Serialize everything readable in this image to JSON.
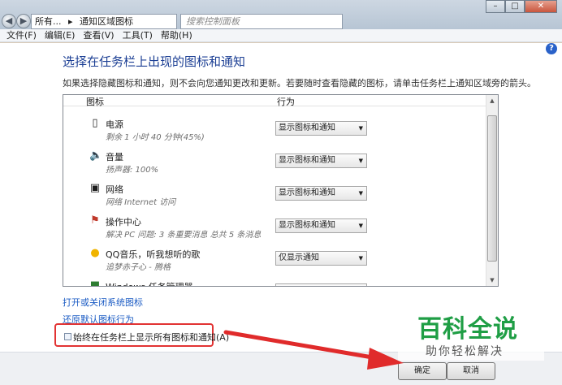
{
  "addressbar": {
    "segments": [
      "所有...",
      "通知区域图标"
    ]
  },
  "search": {
    "placeholder": "搜索控制面板"
  },
  "window_controls": [
    "–",
    "□",
    "✕"
  ],
  "menubar": [
    "文件(F)",
    "编辑(E)",
    "查看(V)",
    "工具(T)",
    "帮助(H)"
  ],
  "help_icon": "?",
  "heading": "选择在任务栏上出现的图标和通知",
  "description": "如果选择隐藏图标和通知，则不会向您通知更改和更新。若要随时查看隐藏的图标，请单击任务栏上通知区域旁的箭头。",
  "list": {
    "col_icon": "图标",
    "col_behavior": "行为",
    "rows": [
      {
        "name": "电源",
        "sub": "剩余 1 小时 40 分钟(45%)",
        "behavior": "显示图标和通知",
        "icon": "battery-icon"
      },
      {
        "name": "音量",
        "sub": "扬声器: 100%",
        "behavior": "显示图标和通知",
        "icon": "speaker-icon"
      },
      {
        "name": "网络",
        "sub": "网络 Internet 访问",
        "behavior": "显示图标和通知",
        "icon": "network-icon"
      },
      {
        "name": "操作中心",
        "sub": "解决 PC 问题: 3 条重要消息 总共 5 条消息",
        "behavior": "显示图标和通知",
        "icon": "flag-icon"
      },
      {
        "name": "QQ音乐，听我想听的歌",
        "sub": "追梦赤子心 - 腾格",
        "behavior": "仅显示通知",
        "icon": "qq-music-icon"
      },
      {
        "name": "Windows 任务管理器",
        "sub": "",
        "behavior": "",
        "icon": "task-manager-icon"
      }
    ]
  },
  "links": {
    "toggle_system_icons": "打开或关闭系统图标",
    "restore_defaults": "还原默认图标行为"
  },
  "checkbox": {
    "label": "始终在任务栏上显示所有图标和通知(A)",
    "checked": false
  },
  "buttons": {
    "ok": "确定",
    "cancel": "取消"
  },
  "watermark": {
    "line1": "百科全说",
    "line2": "助你轻松解决"
  },
  "colors": {
    "heading": "#1c3f94",
    "link": "#1c5cc4",
    "highlight": "#e23333",
    "watermark": "#1f9e45"
  }
}
